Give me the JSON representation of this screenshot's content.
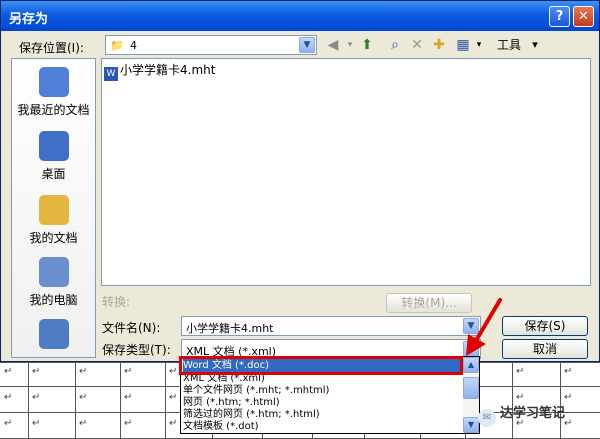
{
  "window": {
    "title": "另存为",
    "help_glyph": "?",
    "close_glyph": "✕"
  },
  "location": {
    "label": "保存位置(I):",
    "value": "4"
  },
  "toolbar": {
    "tools_label": "工具(L)",
    "tools_arrow": "▾"
  },
  "places": [
    {
      "label": "我最近的文档",
      "color": "#4f7fd8"
    },
    {
      "label": "桌面",
      "color": "#3f6fc6"
    },
    {
      "label": "我的文档",
      "color": "#e3b640"
    },
    {
      "label": "我的电脑",
      "color": "#6a8fcf"
    },
    {
      "label": "",
      "color": "#4e7dc4"
    }
  ],
  "files": [
    {
      "name": "小学学籍卡4.mht",
      "icon": "W"
    }
  ],
  "convert": {
    "label": "转换:",
    "button": "转换(M)..."
  },
  "filename": {
    "label": "文件名(N):",
    "value": "小学学籍卡4.mht"
  },
  "filetype": {
    "label": "保存类型(T):",
    "value": "XML 文档 (*.xml)"
  },
  "buttons": {
    "save": "保存(S)",
    "cancel": "取消"
  },
  "dropdown_options": [
    "Word 文档 (*.doc)",
    "XML 文档 (*.xml)",
    "单个文件网页 (*.mht; *.mhtml)",
    "网页 (*.htm; *.html)",
    "筛选过的网页 (*.htm; *.html)",
    "文档模板 (*.dot)"
  ],
  "selected_option_index": 0,
  "accent_colors": {
    "selection": "#316ac5",
    "highlight_box": "#e00000",
    "title_bar": "#0a5de0"
  },
  "doc_table_mark": "↵",
  "watermark": {
    "text": "达学习笔记",
    "glyph": "✉"
  }
}
